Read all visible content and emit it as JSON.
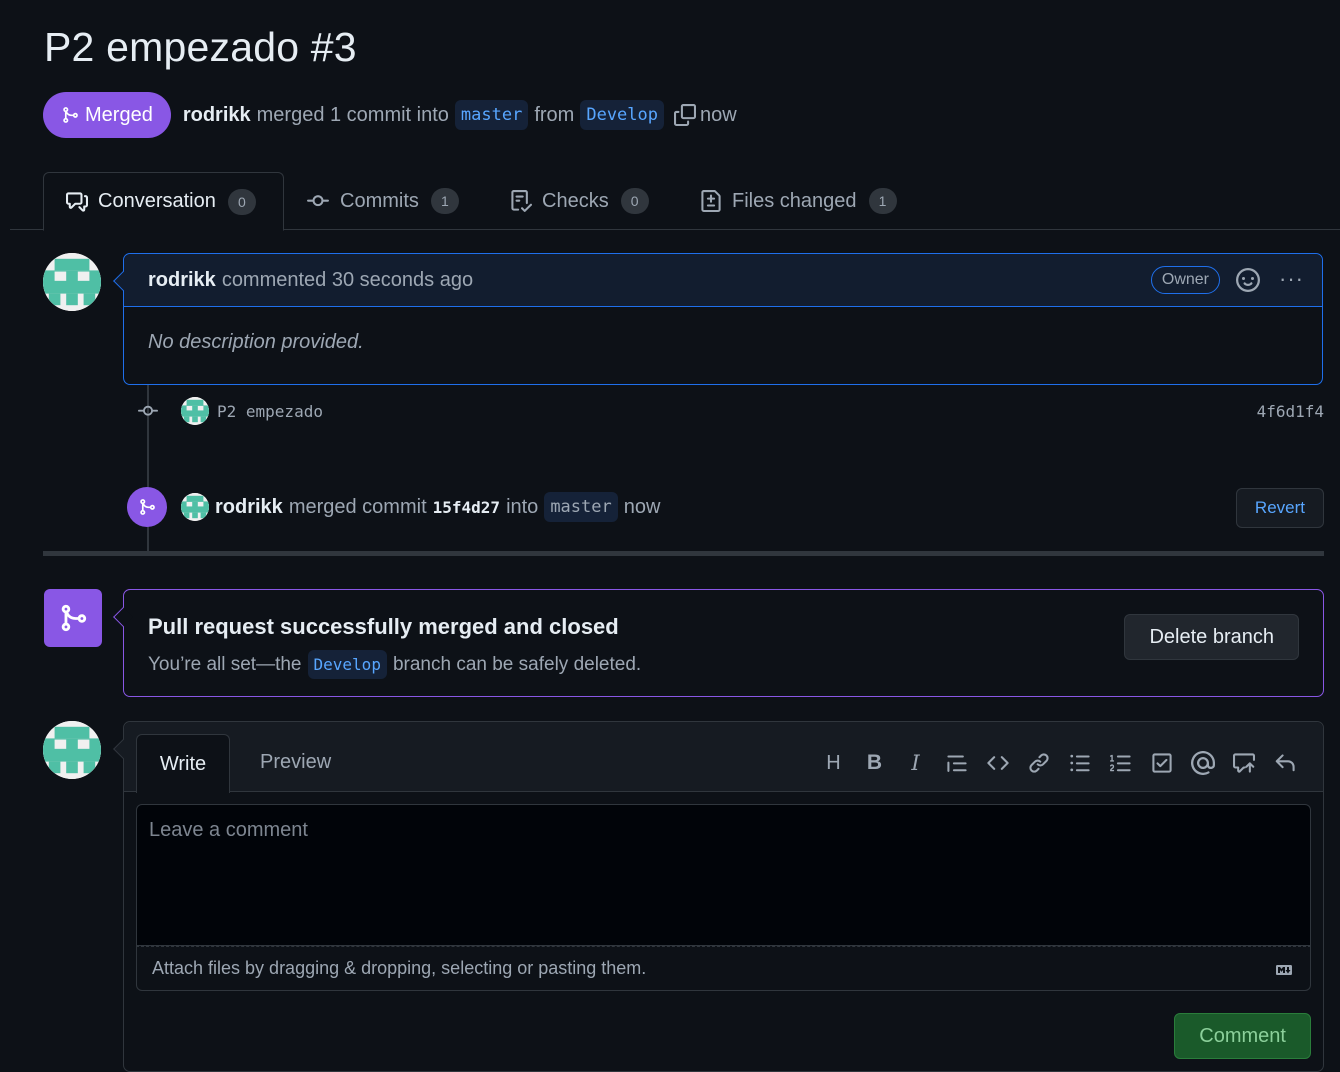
{
  "pr": {
    "title": "P2 empezado #3",
    "state_label": "Merged",
    "author": "rodrikk",
    "merge_text": "merged 1 commit into",
    "base_branch": "master",
    "from_text": "from",
    "head_branch": "Develop",
    "time": "now"
  },
  "tabs": [
    {
      "label": "Conversation",
      "count": "0"
    },
    {
      "label": "Commits",
      "count": "1"
    },
    {
      "label": "Checks",
      "count": "0"
    },
    {
      "label": "Files changed",
      "count": "1"
    }
  ],
  "comment": {
    "author": "rodrikk",
    "action": "commented 30 seconds ago",
    "role": "Owner",
    "body": "No description provided."
  },
  "commit": {
    "message": "P2 empezado",
    "sha": "4f6d1f4"
  },
  "merge_event": {
    "author": "rodrikk",
    "text1": "merged commit",
    "sha": "15f4d27",
    "text2": "into",
    "branch": "master",
    "time": "now",
    "revert_label": "Revert"
  },
  "merged_box": {
    "title": "Pull request successfully merged and closed",
    "sub_before": "You’re all set—the",
    "branch": "Develop",
    "sub_after": "branch can be safely deleted.",
    "delete_label": "Delete branch"
  },
  "editor": {
    "write_tab": "Write",
    "preview_tab": "Preview",
    "placeholder": "Leave a comment",
    "attach_text": "Attach files by dragging & dropping, selecting or pasting them.",
    "submit_label": "Comment",
    "toolbar": [
      "heading-icon",
      "bold-icon",
      "italic-icon",
      "quote-icon",
      "code-icon",
      "link-icon",
      "unordered-list-icon",
      "ordered-list-icon",
      "task-list-icon",
      "mention-icon",
      "reference-icon",
      "undo-icon"
    ]
  },
  "colors": {
    "merged_purple": "#8957e5",
    "accent_blue": "#1f6feb",
    "link_blue": "#58a6ff",
    "bg": "#0d1117"
  }
}
